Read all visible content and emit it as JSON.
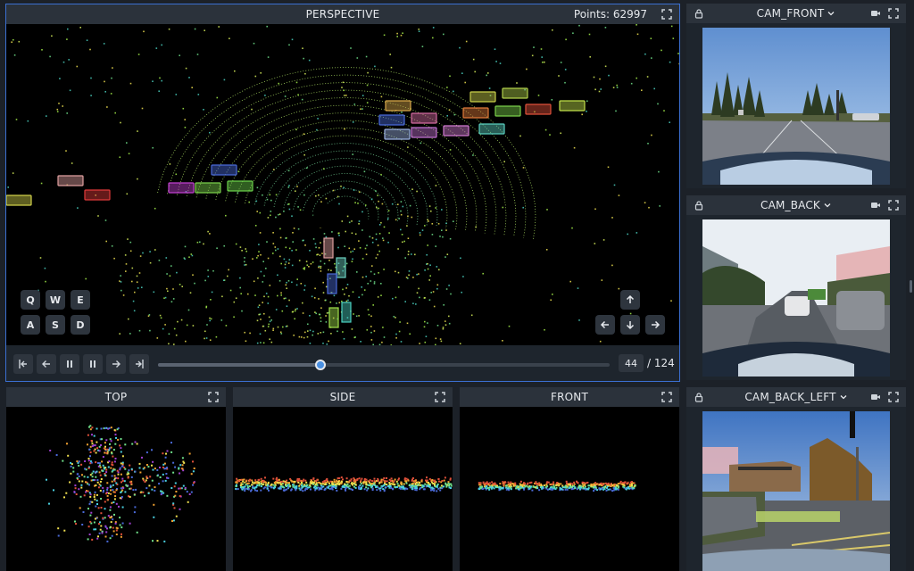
{
  "perspective": {
    "title": "PERSPECTIVE",
    "points_label": "Points: 62997",
    "keys_top": [
      "Q",
      "W",
      "E"
    ],
    "keys_bottom": [
      "A",
      "S",
      "D"
    ]
  },
  "timeline": {
    "current_frame": "44",
    "total_label": "/ 124",
    "progress": 0.36
  },
  "views": {
    "top": "TOP",
    "side": "SIDE",
    "front": "FRONT"
  },
  "cameras": {
    "front": "CAM_FRONT",
    "back": "CAM_BACK",
    "back_left": "CAM_BACK_LEFT"
  },
  "colors": {
    "accent": "#4a90e2",
    "panel_header": "#2b323b",
    "background": "#1c2128"
  }
}
